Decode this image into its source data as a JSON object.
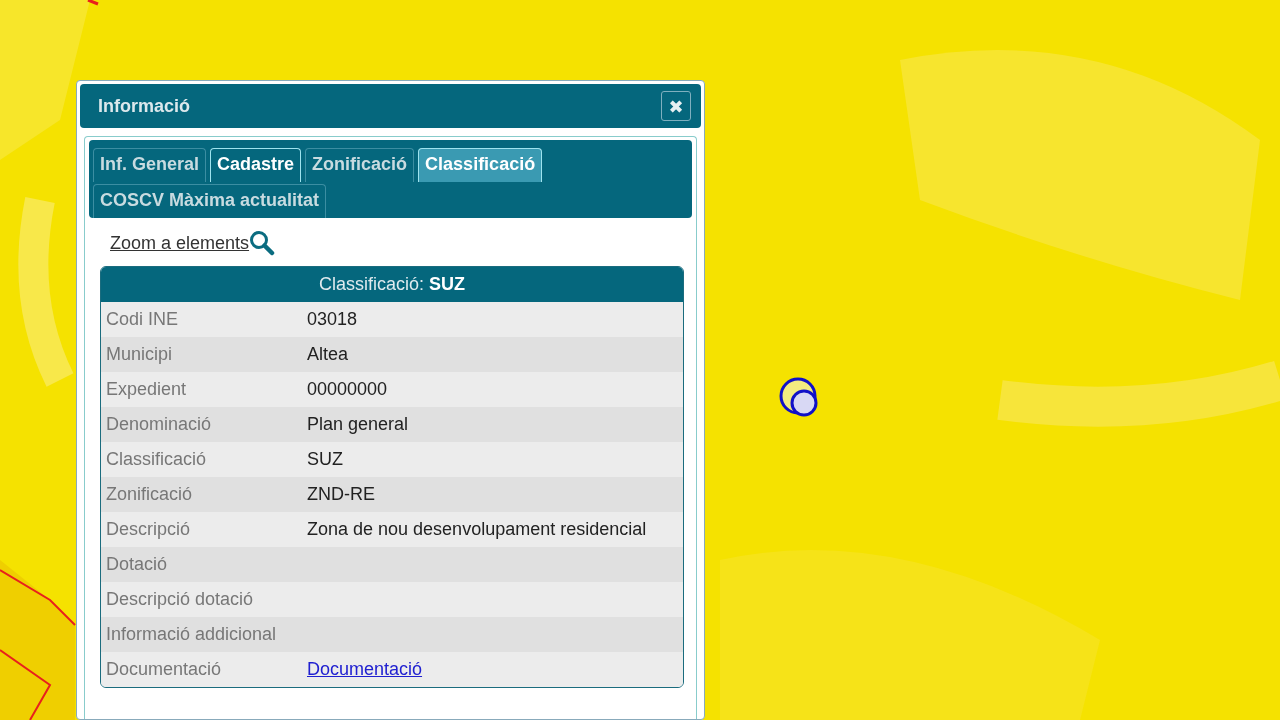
{
  "dialog": {
    "title": "Informació",
    "close_label": "✖"
  },
  "tabs": [
    {
      "label": "Inf. General",
      "selected": false,
      "focused": false
    },
    {
      "label": "Cadastre",
      "selected": false,
      "focused": true
    },
    {
      "label": "Zonificació",
      "selected": false,
      "focused": false
    },
    {
      "label": "Classificació",
      "selected": true,
      "focused": false
    },
    {
      "label": "COSCV Màxima actualitat",
      "selected": false,
      "focused": false
    }
  ],
  "zoom_link": "Zoom a elements",
  "table": {
    "title": "Classificació: **SUZ**",
    "rows": [
      {
        "label": "Codi INE",
        "value": "03018",
        "kind": "text"
      },
      {
        "label": "Municipi",
        "value": "Altea",
        "kind": "text"
      },
      {
        "label": "Expedient",
        "value": "00000000",
        "kind": "text"
      },
      {
        "label": "Denominació",
        "value": "Plan general",
        "kind": "text"
      },
      {
        "label": "Classificació",
        "value": "SUZ",
        "kind": "text"
      },
      {
        "label": "Zonificació",
        "value": "ZND-RE",
        "kind": "text"
      },
      {
        "label": "Descripció",
        "value": "Zona de nou desenvolupament residencial",
        "kind": "text"
      },
      {
        "label": "Dotació",
        "kind": "empty"
      },
      {
        "label": "Descripció dotació",
        "kind": "empty"
      },
      {
        "label": "Informació addicional",
        "kind": "empty"
      },
      {
        "label": "Documentació",
        "value": "Documentació",
        "kind": "link"
      }
    ]
  }
}
